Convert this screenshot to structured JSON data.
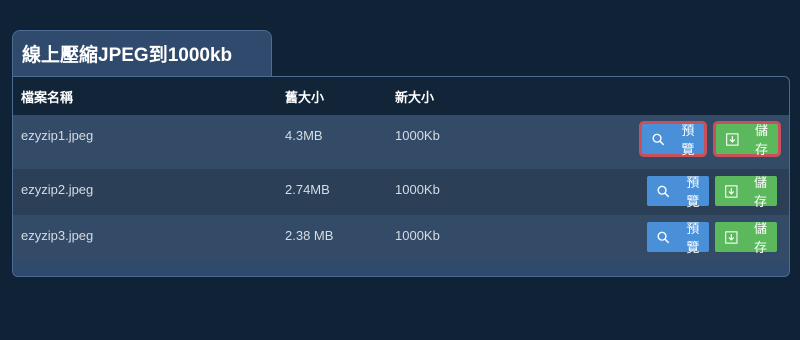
{
  "header": {
    "title": "線上壓縮JPEG到1000kb"
  },
  "table": {
    "columns": [
      "檔案名稱",
      "舊大小",
      "新大小",
      ""
    ],
    "rows": [
      {
        "filename": "ezyzip1.jpeg",
        "old_size": "4.3MB",
        "new_size": "1000Kb",
        "preview_label": "預覽",
        "save_label": "儲存"
      },
      {
        "filename": "ezyzip2.jpeg",
        "old_size": "2.74MB",
        "new_size": "1000Kb",
        "preview_label": "預覽",
        "save_label": "儲存"
      },
      {
        "filename": "ezyzip3.jpeg",
        "old_size": "2.38 MB",
        "new_size": "1000Kb",
        "preview_label": "預覽",
        "save_label": "儲存"
      }
    ]
  },
  "icons": {
    "preview": "search-icon",
    "save": "download-icon"
  },
  "colors": {
    "background": "#0f2236",
    "panel": "#2f4a6c",
    "header_row": "#122438",
    "preview_button": "#4a90d9",
    "save_button": "#5cb85c",
    "highlight": "#c9505a"
  }
}
